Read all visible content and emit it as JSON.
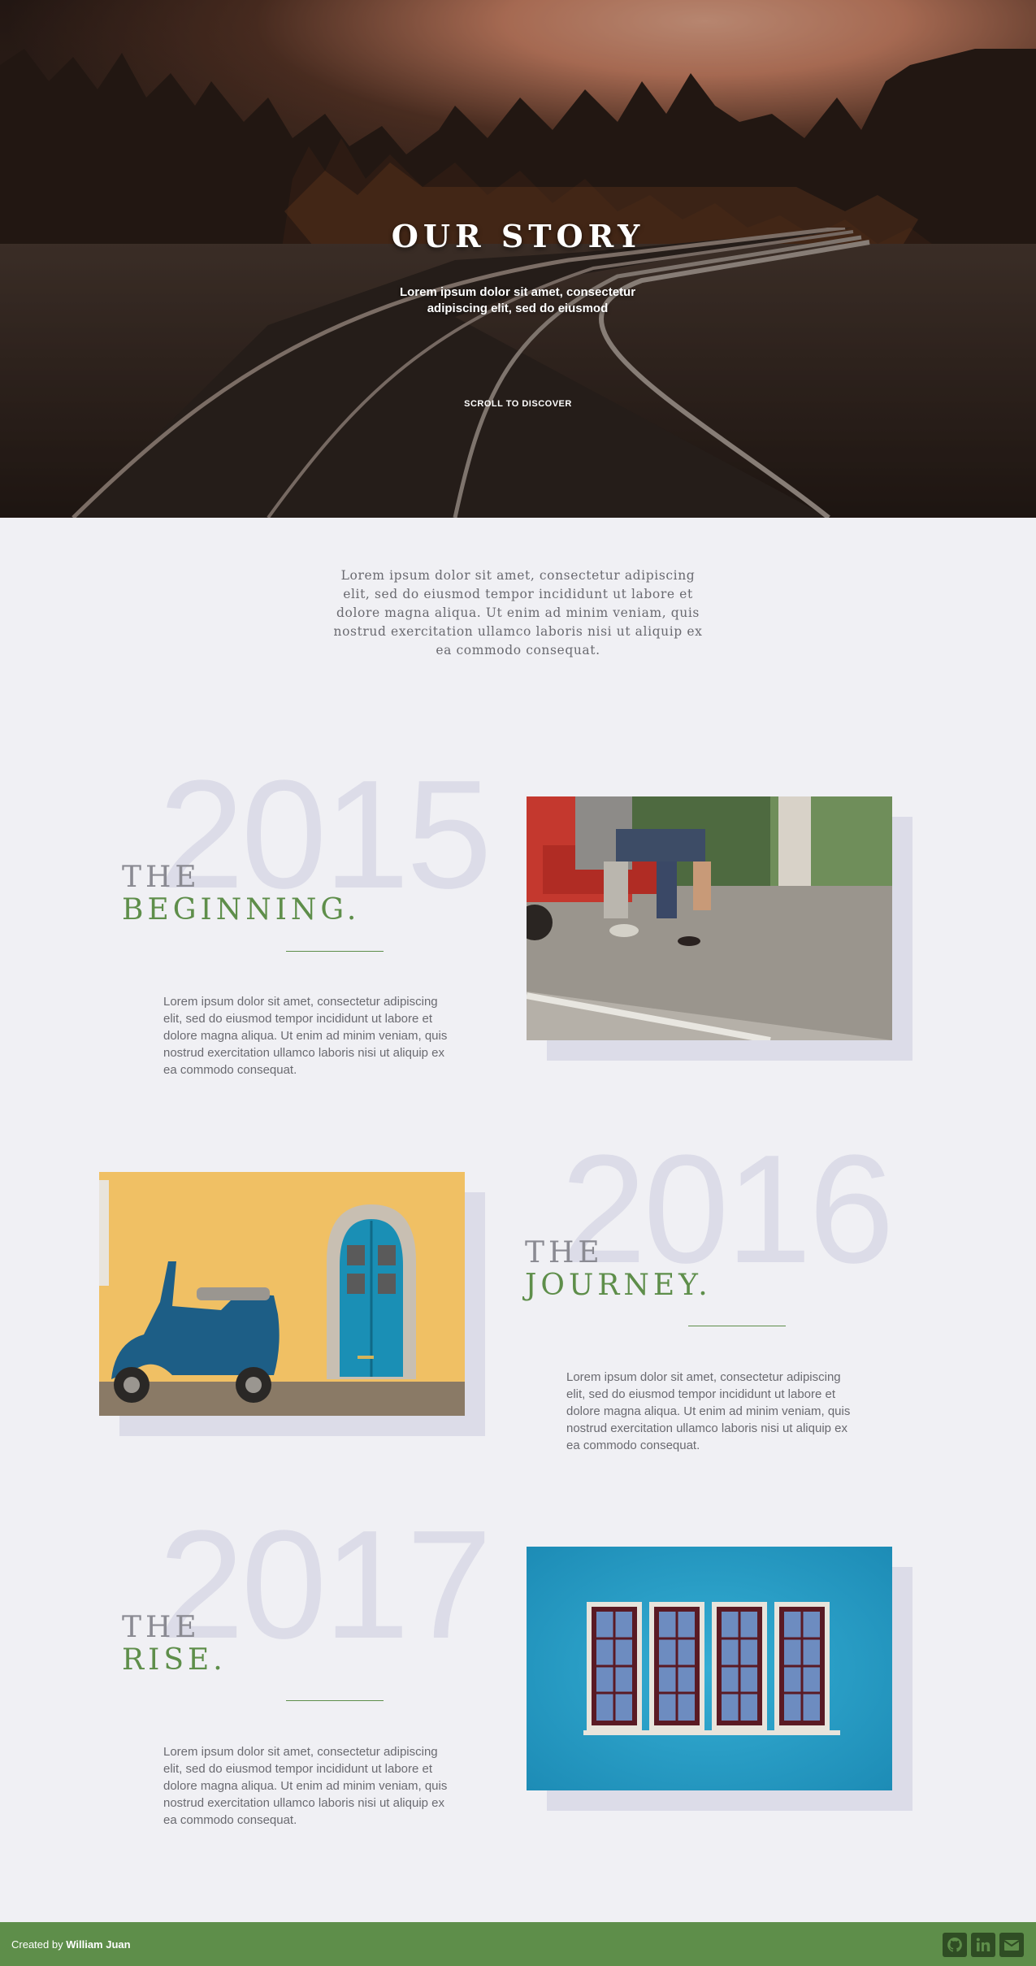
{
  "hero": {
    "title": "OUR STORY",
    "subtitle": "Lorem ipsum dolor sit amet, consectetur adipiscing elit, sed do eiusmod",
    "scroll_label": "SCROLL TO DISCOVER"
  },
  "intro": {
    "text": "Lorem ipsum dolor sit amet, consectetur adipiscing elit, sed do eiusmod tempor incididunt ut labore et dolore magna aliqua. Ut enim ad minim veniam, quis nostrud exercitation ullamco laboris nisi ut aliquip ex ea commodo consequat."
  },
  "timeline": [
    {
      "year": "2015",
      "the": "THE",
      "heading": "BEGINNING.",
      "text": "Lorem ipsum dolor sit amet, consectetur adipiscing elit, sed do eiusmod tempor incididunt ut labore et dolore magna aliqua. Ut enim ad minim veniam, quis nostrud exercitation ullamco laboris nisi ut aliquip ex ea commodo consequat.",
      "image": "people-sitting-on-truck-tailgate"
    },
    {
      "year": "2016",
      "the": "THE",
      "heading": "JOURNEY.",
      "text": "Lorem ipsum dolor sit amet, consectetur adipiscing elit, sed do eiusmod tempor incididunt ut labore et dolore magna aliqua. Ut enim ad minim veniam, quis nostrud exercitation ullamco laboris nisi ut aliquip ex ea commodo consequat.",
      "image": "blue-scooter-yellow-wall"
    },
    {
      "year": "2017",
      "the": "THE",
      "heading": "RISE.",
      "text": "Lorem ipsum dolor sit amet, consectetur adipiscing elit, sed do eiusmod tempor incididunt ut labore et dolore magna aliqua. Ut enim ad minim veniam, quis nostrud exercitation ullamco laboris nisi ut aliquip ex ea commodo consequat.",
      "image": "windows-on-blue-wall"
    }
  ],
  "footer": {
    "credit_prefix": "Created by",
    "credit_name": "William Juan",
    "icons": [
      "github-icon",
      "linkedin-icon",
      "email-icon"
    ]
  },
  "colors": {
    "accent": "#5e8e4a",
    "background": "#f0f0f4",
    "year_watermark": "#dcdce8",
    "text": "#6a6a70"
  }
}
